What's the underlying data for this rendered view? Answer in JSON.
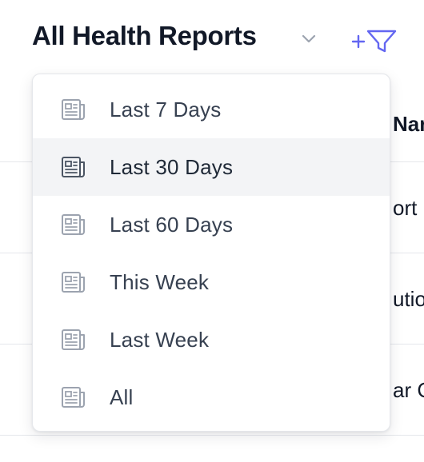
{
  "header": {
    "title": "All Health Reports"
  },
  "icons": {
    "chevron": "chevron-down-icon",
    "add_filter": "add-filter-icon",
    "report": "newspaper-icon"
  },
  "colors": {
    "accent": "#6366f1",
    "text_primary": "#111827",
    "menu_text": "#374151",
    "icon_gray": "#9ca3af",
    "highlight": "#f3f4f6"
  },
  "table": {
    "column_header": "Nar",
    "rows": [
      "ort",
      "utio",
      "ar C"
    ]
  },
  "dropdown": {
    "selected_index": 1,
    "items": [
      {
        "label": "Last 7 Days"
      },
      {
        "label": "Last 30 Days"
      },
      {
        "label": "Last 60 Days"
      },
      {
        "label": "This Week"
      },
      {
        "label": "Last Week"
      },
      {
        "label": "All"
      }
    ]
  }
}
